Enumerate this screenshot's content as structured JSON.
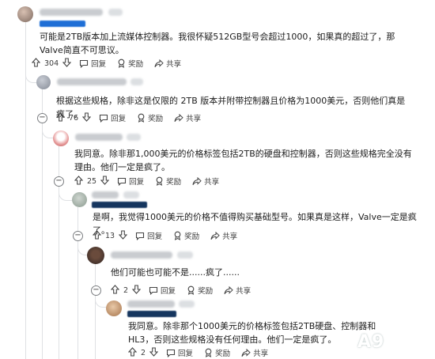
{
  "comments": [
    {
      "body": "可能是2TB版本加上流媒体控制器。我很怀疑512GB型号会超过1000，如果真的超过了，那Valve简直不可思议。",
      "votes": "304",
      "reply_label": "回复",
      "award_label": "奖励",
      "share_label": "共享"
    },
    {
      "body": "根据这些规格，除非这是仅限的 2TB 版本并附带控制器且价格为1000美元，否则他们真是疯了。",
      "votes": "76",
      "reply_label": "回复",
      "award_label": "奖励",
      "share_label": "共享"
    },
    {
      "body": "我同意。除非那1,000美元的价格标签包括2TB的硬盘和控制器，否则这些规格完全没有理由。他们一定是疯了。",
      "votes": "25",
      "reply_label": "回复",
      "award_label": "奖励",
      "share_label": "共享"
    },
    {
      "body": "是啊，我觉得1000美元的价格不值得购买基础型号。如果真是这样，Valve一定是疯了。",
      "votes": "13",
      "reply_label": "回复",
      "award_label": "奖励",
      "share_label": "共享"
    },
    {
      "body": "他们可能也可能不是......疯了......",
      "votes": "2",
      "reply_label": "回复",
      "award_label": "奖励",
      "share_label": "共享"
    },
    {
      "body": "我同意。除非那个1000美元的价格标签包括2TB硬盘、控制器和HL3，否则这些规格没有任何理由。他们一定是疯了。",
      "votes": "2",
      "reply_label": "回复",
      "award_label": "奖励",
      "share_label": "共享"
    }
  ],
  "collapse_symbol": "−",
  "colors": {
    "badge": "#1f6fd6",
    "thread_line": "#dfe1e4",
    "text": "#1c1c1c"
  },
  "icons": [
    "upvote-icon",
    "downvote-icon",
    "reply-icon",
    "award-icon",
    "share-icon"
  ]
}
